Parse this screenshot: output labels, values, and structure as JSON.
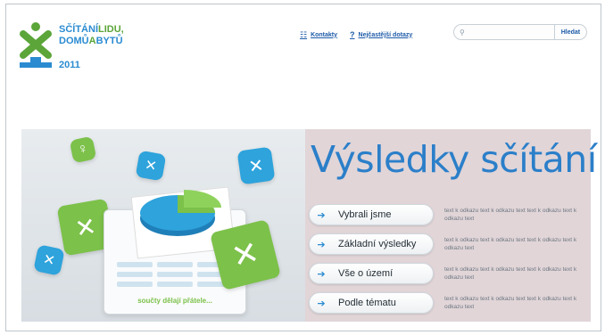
{
  "header": {
    "logo_line1_a": "SČÍTÁNÍ",
    "logo_line1_b": "LIDU,",
    "logo_line2_a": "DOMŮ",
    "logo_line2_b": "A",
    "logo_line2_c": "BYTŮ",
    "logo_year": "2011",
    "links": [
      {
        "label": "Kontakty",
        "icon": "contacts-icon"
      },
      {
        "label": "Nejčastější dotazy",
        "icon": "question-icon"
      }
    ],
    "search": {
      "placeholder": "",
      "button_label": "Hledat"
    }
  },
  "banner": {
    "title": "Výsledky sčítání",
    "illustration_caption": "součty dělají přátele...",
    "menu": [
      {
        "label": "Vybrali jsme",
        "desc": "text k odkazu text k odkazu text text k odkazu text k odkazu text"
      },
      {
        "label": "Základní výsledky",
        "desc": "text k odkazu text k odkazu text text k odkazu text k odkazu text"
      },
      {
        "label": "Vše o území",
        "desc": "text k odkazu text k odkazu text text k odkazu text k odkazu text"
      },
      {
        "label": "Podle tématu",
        "desc": "text k odkazu text k odkazu text text k odkazu text k odkazu text"
      }
    ]
  },
  "colors": {
    "brand_blue": "#2a8bd1",
    "brand_green": "#5ba539",
    "link_blue": "#1c5aa8",
    "tile_blue": "#2ea3dc",
    "tile_green": "#7cc14a"
  }
}
